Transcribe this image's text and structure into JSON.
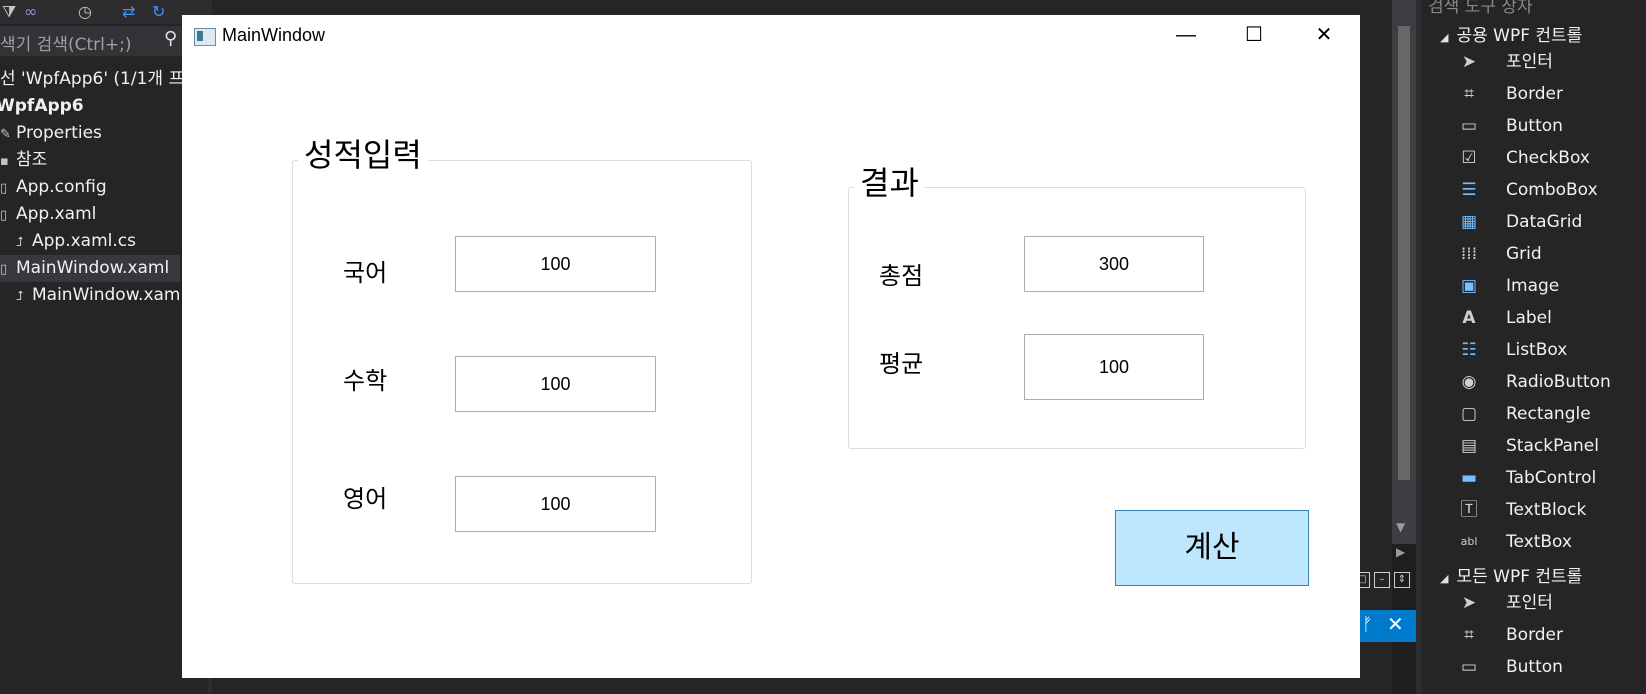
{
  "solution_explorer": {
    "search_placeholder": "색기 검색(Ctrl+;)",
    "items": [
      {
        "label": "선 'WpfApp6' (1/1개 프",
        "icon": ""
      },
      {
        "label": "WpfApp6",
        "icon": ""
      },
      {
        "label": "Properties",
        "icon": "wrench-icon"
      },
      {
        "label": "참조",
        "icon": "reference-icon"
      },
      {
        "label": "App.config",
        "icon": "file-icon"
      },
      {
        "label": "App.xaml",
        "icon": "file-icon"
      },
      {
        "label": "App.xaml.cs",
        "icon": "csharp-file-icon"
      },
      {
        "label": "MainWindow.xaml",
        "icon": "file-icon"
      },
      {
        "label": "MainWindow.xam",
        "icon": "csharp-file-icon"
      }
    ]
  },
  "window": {
    "title": "MainWindow",
    "controls": {
      "minimize": "—",
      "maximize": "☐",
      "close": "✕"
    }
  },
  "grade_input": {
    "title": "성적입력",
    "fields": [
      {
        "label": "국어",
        "value": "100"
      },
      {
        "label": "수학",
        "value": "100"
      },
      {
        "label": "영어",
        "value": "100"
      }
    ]
  },
  "result": {
    "title": "결과",
    "fields": [
      {
        "label": "총점",
        "value": "300"
      },
      {
        "label": "평균",
        "value": "100"
      }
    ]
  },
  "calc_button": {
    "label": "계산",
    "color": "#bee6fd"
  },
  "toolbox": {
    "header_partial": "검색 도구 상자",
    "categories": [
      {
        "name": "공용 WPF 컨트롤",
        "items": [
          {
            "label": "포인터",
            "icon": "pointer-icon"
          },
          {
            "label": "Border",
            "icon": "border-icon"
          },
          {
            "label": "Button",
            "icon": "button-icon"
          },
          {
            "label": "CheckBox",
            "icon": "checkbox-icon"
          },
          {
            "label": "ComboBox",
            "icon": "combobox-icon"
          },
          {
            "label": "DataGrid",
            "icon": "datagrid-icon"
          },
          {
            "label": "Grid",
            "icon": "grid-icon"
          },
          {
            "label": "Image",
            "icon": "image-icon"
          },
          {
            "label": "Label",
            "icon": "label-icon"
          },
          {
            "label": "ListBox",
            "icon": "listbox-icon"
          },
          {
            "label": "RadioButton",
            "icon": "radiobutton-icon"
          },
          {
            "label": "Rectangle",
            "icon": "rectangle-icon"
          },
          {
            "label": "StackPanel",
            "icon": "stackpanel-icon"
          },
          {
            "label": "TabControl",
            "icon": "tabcontrol-icon"
          },
          {
            "label": "TextBlock",
            "icon": "textblock-icon"
          },
          {
            "label": "TextBox",
            "icon": "textbox-icon"
          }
        ]
      },
      {
        "name": "모든 WPF 컨트롤",
        "items": [
          {
            "label": "포인터",
            "icon": "pointer-icon"
          },
          {
            "label": "Border",
            "icon": "border-icon"
          },
          {
            "label": "Button",
            "icon": "button-icon"
          }
        ]
      }
    ]
  },
  "colors": {
    "ide_bg": "#252526",
    "accent": "#007acc",
    "button_bg": "#bee6fd",
    "button_border": "#3c7fb1"
  }
}
